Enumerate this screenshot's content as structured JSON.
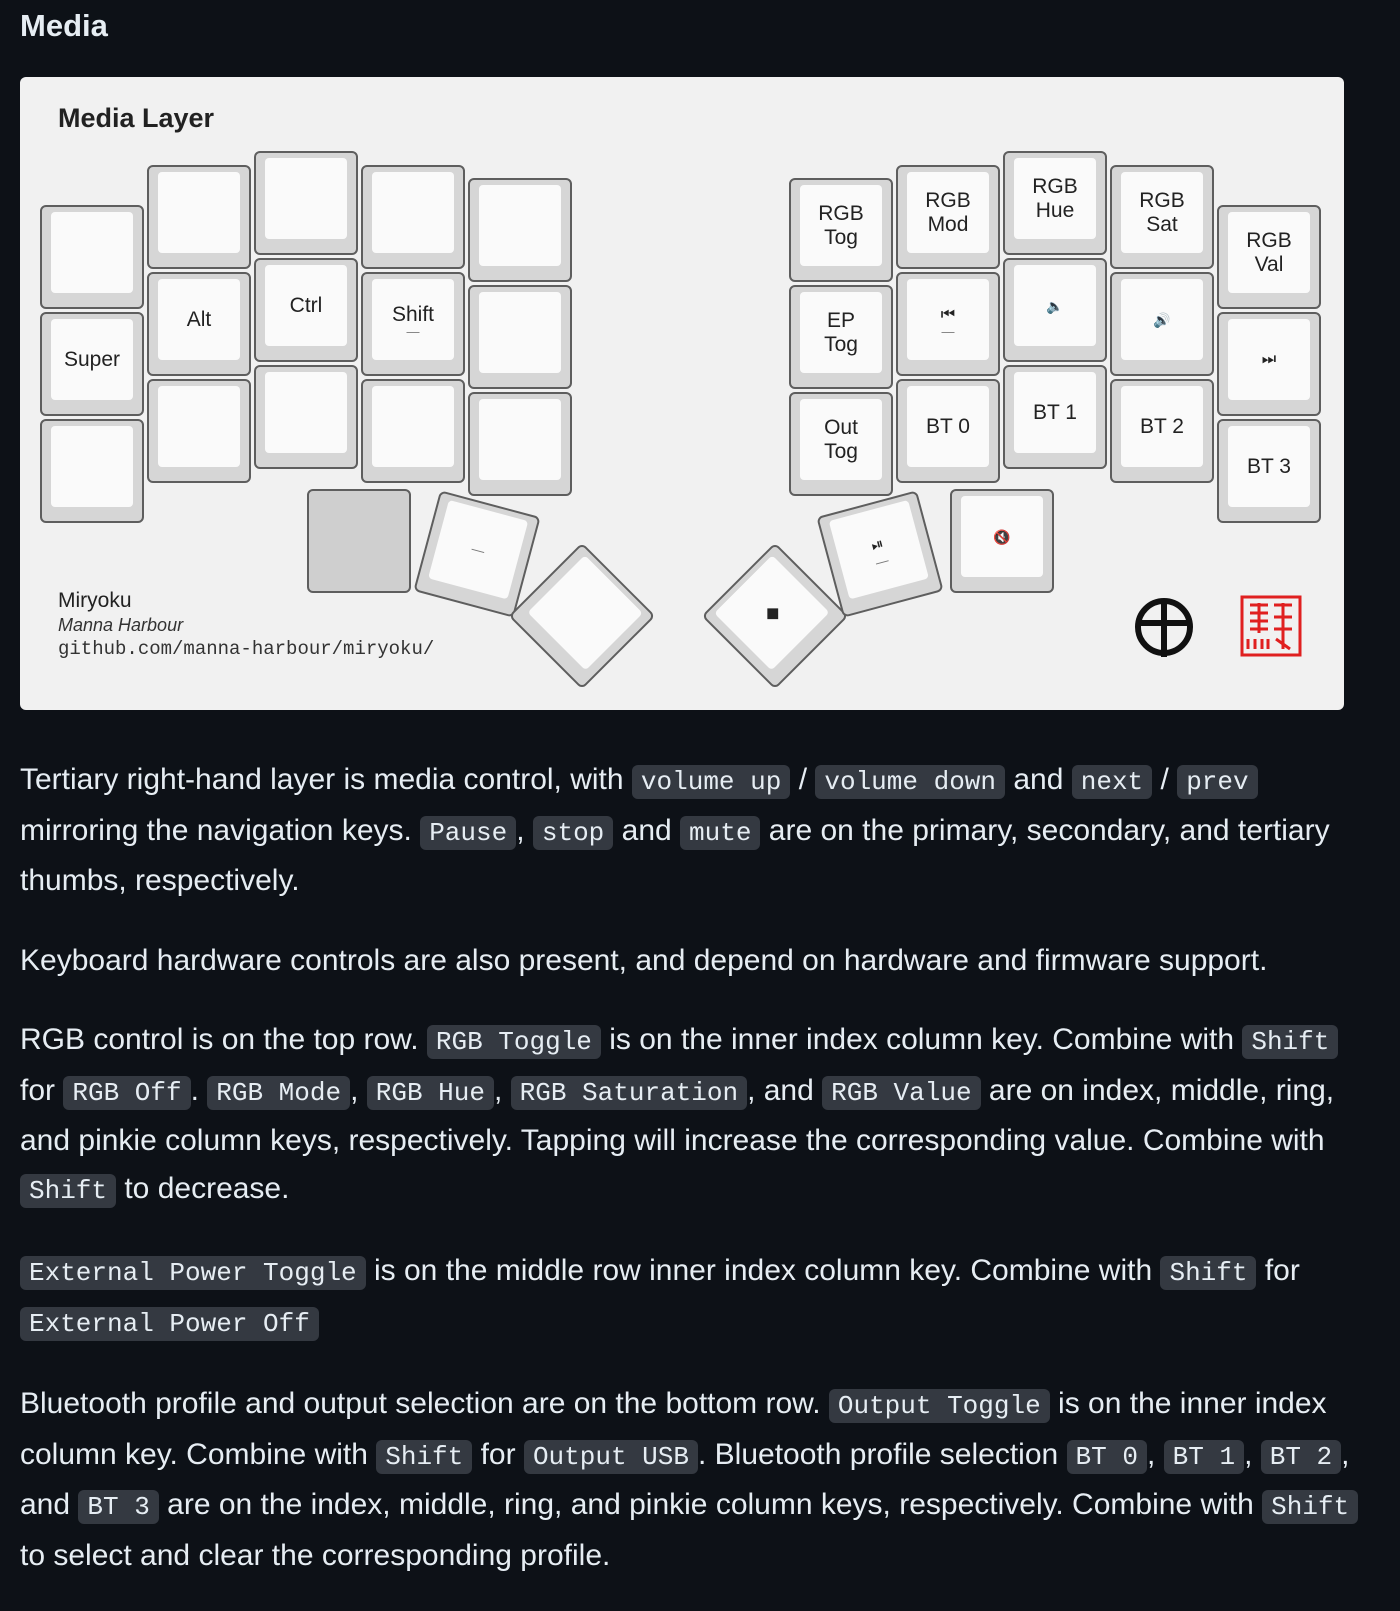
{
  "heading": "Media",
  "figure": {
    "title": "Media Layer",
    "credit_name": "Miryoku",
    "credit_author": "Manna Harbour",
    "credit_url": "github.com/manna-harbour/miryoku/",
    "left_keys": {
      "r0": [
        "",
        "",
        "",
        "",
        ""
      ],
      "r1": [
        "Super",
        "Alt",
        "Ctrl",
        "Shift",
        ""
      ],
      "r1_sub": [
        "",
        "",
        "",
        "—",
        ""
      ],
      "r2": [
        "",
        "",
        "",
        "",
        ""
      ],
      "thumb_sub": [
        "",
        "—",
        ""
      ]
    },
    "right_keys": {
      "r0_line1": [
        "RGB",
        "RGB",
        "RGB",
        "RGB",
        "RGB"
      ],
      "r0_line2": [
        "Tog",
        "Mod",
        "Hue",
        "Sat",
        "Val"
      ],
      "r1_line1": [
        "EP",
        "⏮",
        "🔈",
        "🔊",
        "⏭"
      ],
      "r1_line2": [
        "Tog",
        "",
        "",
        "",
        ""
      ],
      "r1_sub": [
        "",
        "—",
        "",
        "",
        ""
      ],
      "r2_line1": [
        "Out",
        "BT 0",
        "BT 1",
        "BT 2",
        "BT 3"
      ],
      "r2_line2": [
        "Tog",
        "",
        "",
        "",
        ""
      ],
      "thumb": [
        "◆",
        "⏯",
        "🔇"
      ],
      "thumb_sub": [
        "",
        "—",
        ""
      ]
    }
  },
  "p1": {
    "t1": "Tertiary right-hand layer is media control, with ",
    "c1": "volume up",
    "t2": " / ",
    "c2": "volume down",
    "t3": " and ",
    "c3": "next",
    "t4": " / ",
    "c4": "prev",
    "t5": " mirroring the navigation keys. ",
    "c5": "Pause",
    "t6": ", ",
    "c6": "stop",
    "t7": " and ",
    "c7": "mute",
    "t8": " are on the primary, secondary, and tertiary thumbs, respectively."
  },
  "p2": {
    "t1": "Keyboard hardware controls are also present, and depend on hardware and firmware support."
  },
  "p3": {
    "t1": "RGB control is on the top row. ",
    "c1": "RGB Toggle",
    "t2": " is on the inner index column key. Combine with ",
    "c2": "Shift",
    "t3": " for ",
    "c3": "RGB Off",
    "t4": ". ",
    "c4": "RGB Mode",
    "t5": ", ",
    "c5": "RGB Hue",
    "t6": ", ",
    "c6": "RGB Saturation",
    "t7": ", and ",
    "c7": "RGB Value",
    "t8": " are on index, middle, ring, and pinkie column keys, respectively. Tapping will increase the corresponding value. Combine with ",
    "c8": "Shift",
    "t9": " to decrease."
  },
  "p4": {
    "c1": "External Power Toggle",
    "t1": " is on the middle row inner index column key. Combine with ",
    "c2": "Shift",
    "t2": " for ",
    "c3": "External Power Off"
  },
  "p5": {
    "t1": "Bluetooth profile and output selection are on the bottom row. ",
    "c1": "Output Toggle",
    "t2": " is on the inner index column key. Combine with ",
    "c2": "Shift",
    "t3": " for ",
    "c3": "Output USB",
    "t4": ". Bluetooth profile selection ",
    "c4": "BT 0",
    "t5": ", ",
    "c5": "BT 1",
    "t6": ", ",
    "c6": "BT 2",
    "t7": ", and ",
    "c7": "BT 3",
    "t8": " are on the index, middle, ring, and pinkie column keys, respectively. Combine with ",
    "c8": "Shift",
    "t9": " to select and clear the corresponding profile."
  },
  "colors": {
    "background": "#0d1117",
    "text": "#e6edf3",
    "code_bg": "#343941",
    "figure_bg": "#f1f1f1",
    "seal_red": "#e02020"
  }
}
